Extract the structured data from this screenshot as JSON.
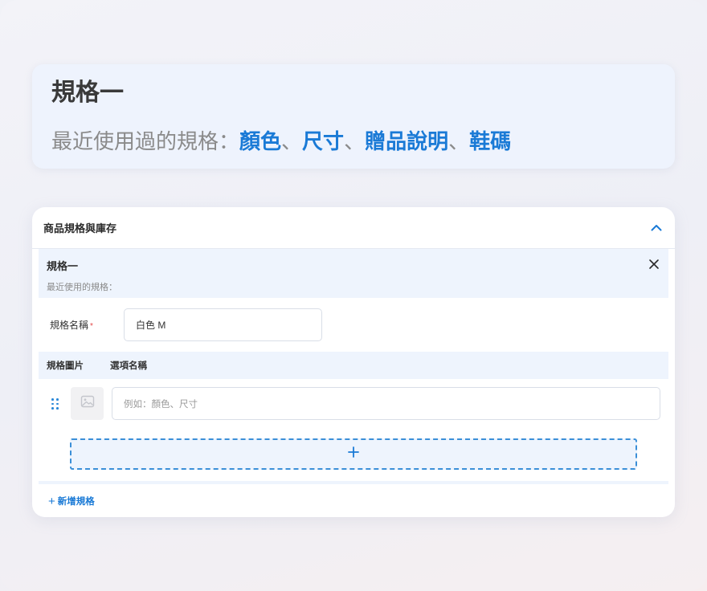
{
  "hero": {
    "title": "規格一",
    "recent_label": "最近使用過的規格：",
    "tags": [
      "顏色",
      "尺寸",
      "贈品說明",
      "鞋碼"
    ],
    "separator": "、"
  },
  "card": {
    "header_title": "商品規格與庫存",
    "spec": {
      "name": "規格一",
      "recent_label": "最近使用的規格：",
      "name_field_label": "規格名稱",
      "required_mark": "*",
      "name_value": "白色 M",
      "columns": [
        "規格圖片",
        "選項名稱"
      ],
      "option_placeholder": "例如：顏色、尺寸",
      "add_option_symbol": "+"
    },
    "add_spec_label": "新增規格"
  },
  "colors": {
    "accent": "#1a7ad6",
    "required": "#e34a4a",
    "panel_bg": "#eef4fd"
  },
  "icons": [
    "chevron-up-icon",
    "close-icon",
    "drag-handle-icon",
    "image-placeholder-icon",
    "plus-icon"
  ]
}
